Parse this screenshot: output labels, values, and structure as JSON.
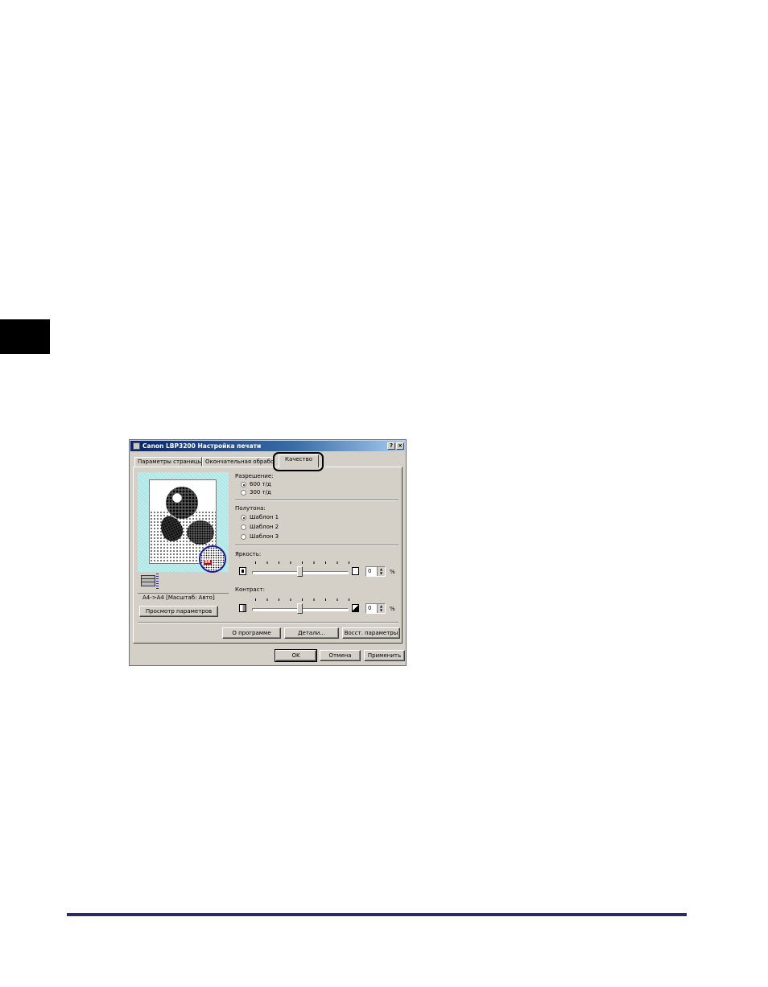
{
  "dialog": {
    "title": "Canon LBP3200 Настройка печати",
    "help_button": "?",
    "close_button": "×"
  },
  "tabs": [
    {
      "label": "Параметры страницы"
    },
    {
      "label": "Окончательная обработка"
    },
    {
      "label": "Качество"
    }
  ],
  "preview": {
    "page_size_text": "A4->A4 [Масштаб: Авто]",
    "zoom_badge": "BR",
    "view_settings_button": "Просмотр параметров"
  },
  "resolution": {
    "label": "Разрешение:",
    "options": [
      {
        "label": "600 т/д",
        "checked": true
      },
      {
        "label": "300 т/д",
        "checked": false
      }
    ]
  },
  "halftone": {
    "label": "Полутона:",
    "options": [
      {
        "label": "Шаблон 1",
        "checked": true
      },
      {
        "label": "Шаблон 2",
        "checked": false
      },
      {
        "label": "Шаблон 3",
        "checked": false
      }
    ]
  },
  "brightness": {
    "label": "Яркость:",
    "value": "0",
    "unit": "%",
    "slider_fraction": 0.5
  },
  "contrast": {
    "label": "Контраст:",
    "value": "0",
    "unit": "%",
    "slider_fraction": 0.5
  },
  "panel_buttons": {
    "about": "О программе",
    "details": "Детали...",
    "restore": "Восст. параметры"
  },
  "footer_buttons": {
    "ok": "OK",
    "cancel": "Отмена",
    "apply": "Применить"
  }
}
